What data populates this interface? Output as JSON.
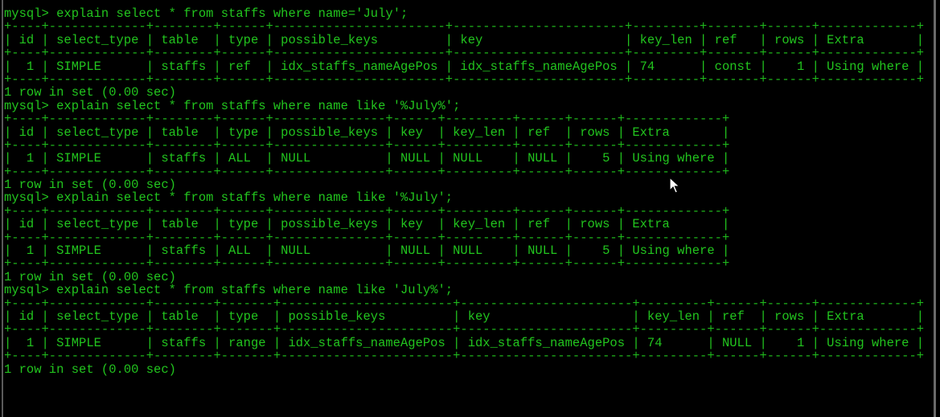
{
  "terminal": {
    "prompt": "mysql> ",
    "text_color": "#22c41e",
    "background": "#000000",
    "queries": [
      {
        "command": "explain select * from staffs where name='July';",
        "columns": [
          "id",
          "select_type",
          "table",
          "type",
          "possible_keys",
          "key",
          "key_len",
          "ref",
          "rows",
          "Extra"
        ],
        "rows": [
          [
            "1",
            "SIMPLE",
            "staffs",
            "ref",
            "idx_staffs_nameAgePos",
            "idx_staffs_nameAgePos",
            "74",
            "const",
            "1",
            "Using where"
          ]
        ],
        "result": "1 row in set (0.00 sec)"
      },
      {
        "command": "explain select * from staffs where name like '%July%';",
        "columns": [
          "id",
          "select_type",
          "table",
          "type",
          "possible_keys",
          "key",
          "key_len",
          "ref",
          "rows",
          "Extra"
        ],
        "rows": [
          [
            "1",
            "SIMPLE",
            "staffs",
            "ALL",
            "NULL",
            "NULL",
            "NULL",
            "NULL",
            "5",
            "Using where"
          ]
        ],
        "result": "1 row in set (0.00 sec)"
      },
      {
        "command": "explain select * from staffs where name like '%July';",
        "columns": [
          "id",
          "select_type",
          "table",
          "type",
          "possible_keys",
          "key",
          "key_len",
          "ref",
          "rows",
          "Extra"
        ],
        "rows": [
          [
            "1",
            "SIMPLE",
            "staffs",
            "ALL",
            "NULL",
            "NULL",
            "NULL",
            "NULL",
            "5",
            "Using where"
          ]
        ],
        "result": "1 row in set (0.00 sec)"
      },
      {
        "command": "explain select * from staffs where name like 'July%';",
        "columns": [
          "id",
          "select_type",
          "table",
          "type",
          "possible_keys",
          "key",
          "key_len",
          "ref",
          "rows",
          "Extra"
        ],
        "rows": [
          [
            "1",
            "SIMPLE",
            "staffs",
            "range",
            "idx_staffs_nameAgePos",
            "idx_staffs_nameAgePos",
            "74",
            "NULL",
            "1",
            "Using where"
          ]
        ],
        "result": "1 row in set (0.00 sec)"
      }
    ]
  },
  "mouse_cursor": "arrow-pointer"
}
